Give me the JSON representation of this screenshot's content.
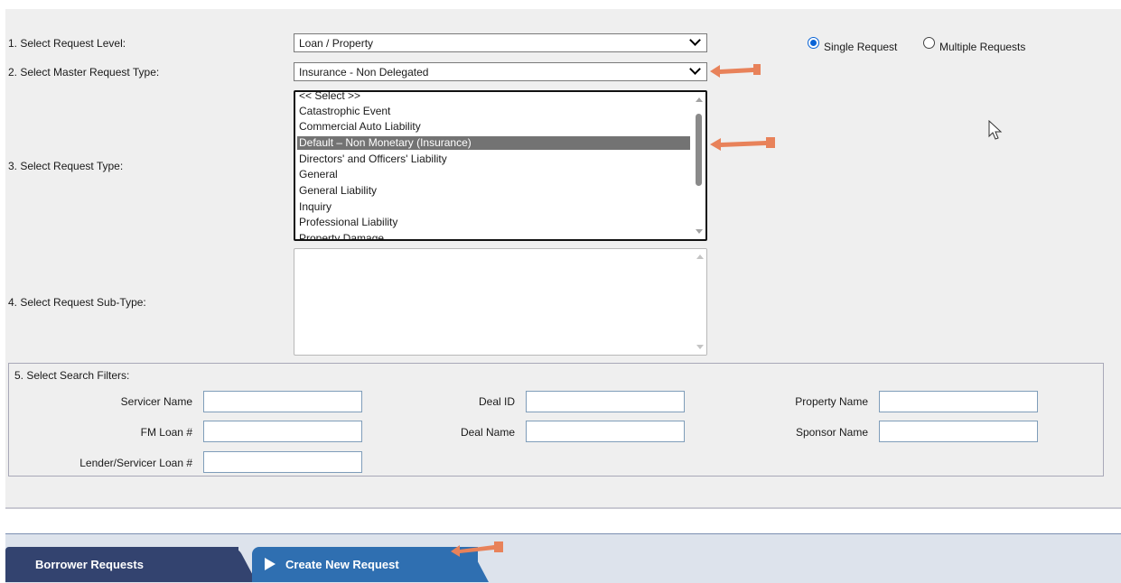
{
  "form": {
    "level": {
      "label": "1. Select Request Level:",
      "value": "Loan / Property"
    },
    "master_type": {
      "label": "2. Select Master Request Type:",
      "value": "Insurance - Non Delegated"
    },
    "request_type": {
      "label": "3. Select Request Type:",
      "options": [
        "<< Select >>",
        "Catastrophic Event",
        "Commercial Auto Liability",
        "Default – Non Monetary (Insurance)",
        "Directors' and Officers' Liability",
        "General",
        "General Liability",
        "Inquiry",
        "Professional Liability",
        "Property Damage"
      ],
      "selected": "Default – Non Monetary (Insurance)"
    },
    "sub_type": {
      "label": "4. Select Request Sub-Type:"
    },
    "mode": {
      "single_label": "Single Request",
      "multiple_label": "Multiple Requests",
      "selected": "single"
    }
  },
  "filters": {
    "legend": "5. Select Search Filters:",
    "servicer_name": {
      "label": "Servicer Name",
      "value": ""
    },
    "fm_loan": {
      "label": "FM Loan #",
      "value": ""
    },
    "lender_loan": {
      "label": "Lender/Servicer Loan #",
      "value": ""
    },
    "deal_id": {
      "label": "Deal ID",
      "value": ""
    },
    "deal_name": {
      "label": "Deal Name",
      "value": ""
    },
    "property_name": {
      "label": "Property Name",
      "value": ""
    },
    "sponsor_name": {
      "label": "Sponsor Name",
      "value": ""
    }
  },
  "tabs": {
    "borrower_requests": "Borrower Requests",
    "create_new_request": "Create New Request",
    "active": "create_new_request"
  },
  "colors": {
    "annotation_arrow": "#e8825a",
    "tab_dark": "#33436f",
    "tab_active": "#2f6fb1",
    "selected_option": "#737373",
    "radio_accent": "#0a64d6"
  },
  "icons": {
    "dropdown": "chevron-down-icon",
    "pointer": "mouse-pointer-icon",
    "annotation": "arrow-left-icon",
    "tab_marker": "play-icon"
  }
}
